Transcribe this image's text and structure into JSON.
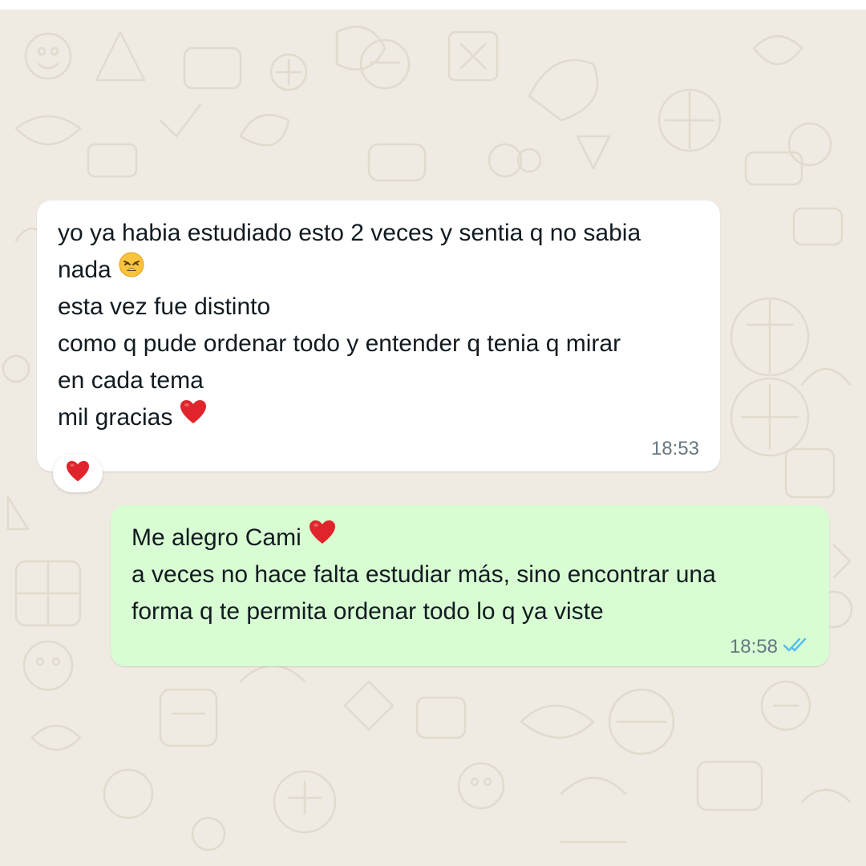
{
  "chat": {
    "background_color": "#efeae2",
    "incoming_bubble_color": "#ffffff",
    "outgoing_bubble_color": "#d9fdd3",
    "tick_color": "#53bdeb"
  },
  "messages": [
    {
      "direction": "incoming",
      "lines": [
        "yo ya habia estudiado esto 2 veces y sentia q no sabia",
        "nada",
        "esta vez fue distinto",
        "como q pude ordenar todo y entender q tenia q mirar",
        "en cada tema",
        "mil gracias"
      ],
      "emojis": [
        "weary-face-emoji",
        "red-heart-emoji"
      ],
      "time": "18:53",
      "reaction": "red-heart-emoji"
    },
    {
      "direction": "outgoing",
      "lines": [
        "Me alegro Cami",
        "a veces no hace falta estudiar más, sino encontrar una",
        "forma q te permita ordenar todo lo q ya viste"
      ],
      "emojis": [
        "red-heart-emoji"
      ],
      "time": "18:58",
      "status_icon": "double-check-read-icon"
    }
  ]
}
